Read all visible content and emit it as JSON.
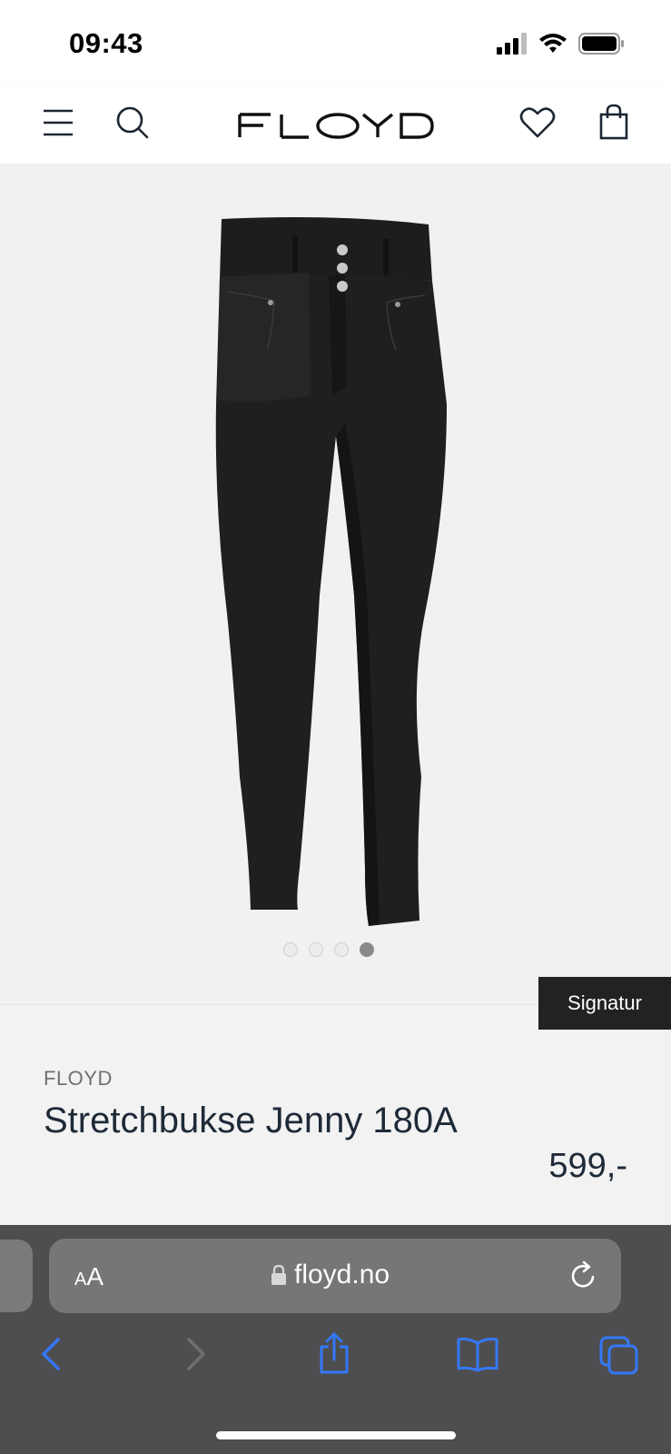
{
  "status": {
    "time": "09:43"
  },
  "header": {
    "logo_text": "FLOYD",
    "icons": [
      "menu-icon",
      "search-icon",
      "heart-icon",
      "shopping-bag-icon"
    ]
  },
  "gallery": {
    "image_count": 4,
    "active_index": 4,
    "badge": "Signatur"
  },
  "product": {
    "brand": "FLOYD",
    "name": "Stretchbukse Jenny 180A",
    "price": "599,-"
  },
  "browser": {
    "text_size_label_small": "A",
    "text_size_label_big": "A",
    "url": "floyd.no"
  },
  "colors": {
    "accent": "#3478f6",
    "dark": "#222222",
    "text": "#1e2a38"
  }
}
